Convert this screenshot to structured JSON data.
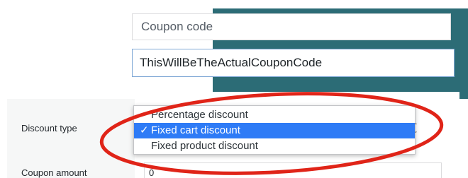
{
  "coupon": {
    "title_placeholder": "Coupon code",
    "code_value": "ThisWillBeTheActualCouponCode"
  },
  "coupon_data": {
    "discount_type_label": "Discount type",
    "coupon_amount_label": "Coupon amount",
    "coupon_amount_value": "0"
  },
  "discount_dropdown": {
    "options": [
      "Percentage discount",
      "Fixed cart discount",
      "Fixed product discount"
    ],
    "selected": "Fixed cart discount",
    "checkmark": "✓"
  },
  "colors": {
    "teal_background": "#2c6c76",
    "selection_highlight": "#2e7bf6",
    "annotation_red": "#e02418"
  }
}
